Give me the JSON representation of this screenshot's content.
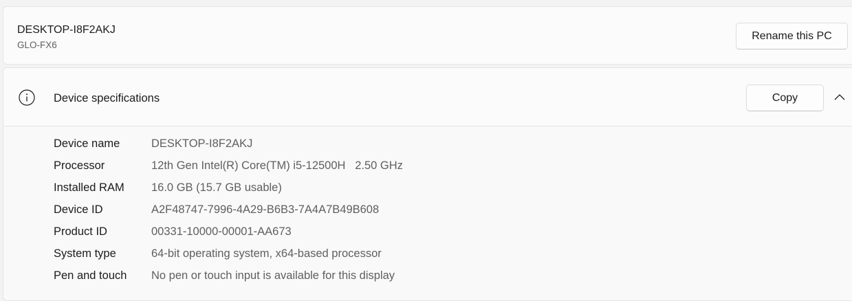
{
  "pc": {
    "name": "DESKTOP-I8F2AKJ",
    "model": "GLO-FX6",
    "rename_label": "Rename this PC"
  },
  "specs": {
    "title": "Device specifications",
    "copy_label": "Copy",
    "rows": [
      {
        "label": "Device name",
        "value": "DESKTOP-I8F2AKJ"
      },
      {
        "label": "Processor",
        "value": "12th Gen Intel(R) Core(TM) i5-12500H   2.50 GHz"
      },
      {
        "label": "Installed RAM",
        "value": "16.0 GB (15.7 GB usable)"
      },
      {
        "label": "Device ID",
        "value": "A2F48747-7996-4A29-B6B3-7A4A7B49B608"
      },
      {
        "label": "Product ID",
        "value": "00331-10000-00001-AA673"
      },
      {
        "label": "System type",
        "value": "64-bit operating system, x64-based processor"
      },
      {
        "label": "Pen and touch",
        "value": "No pen or touch input is available for this display"
      }
    ]
  },
  "icons": {
    "info": "info-icon",
    "collapse": "chevron-up-icon"
  }
}
